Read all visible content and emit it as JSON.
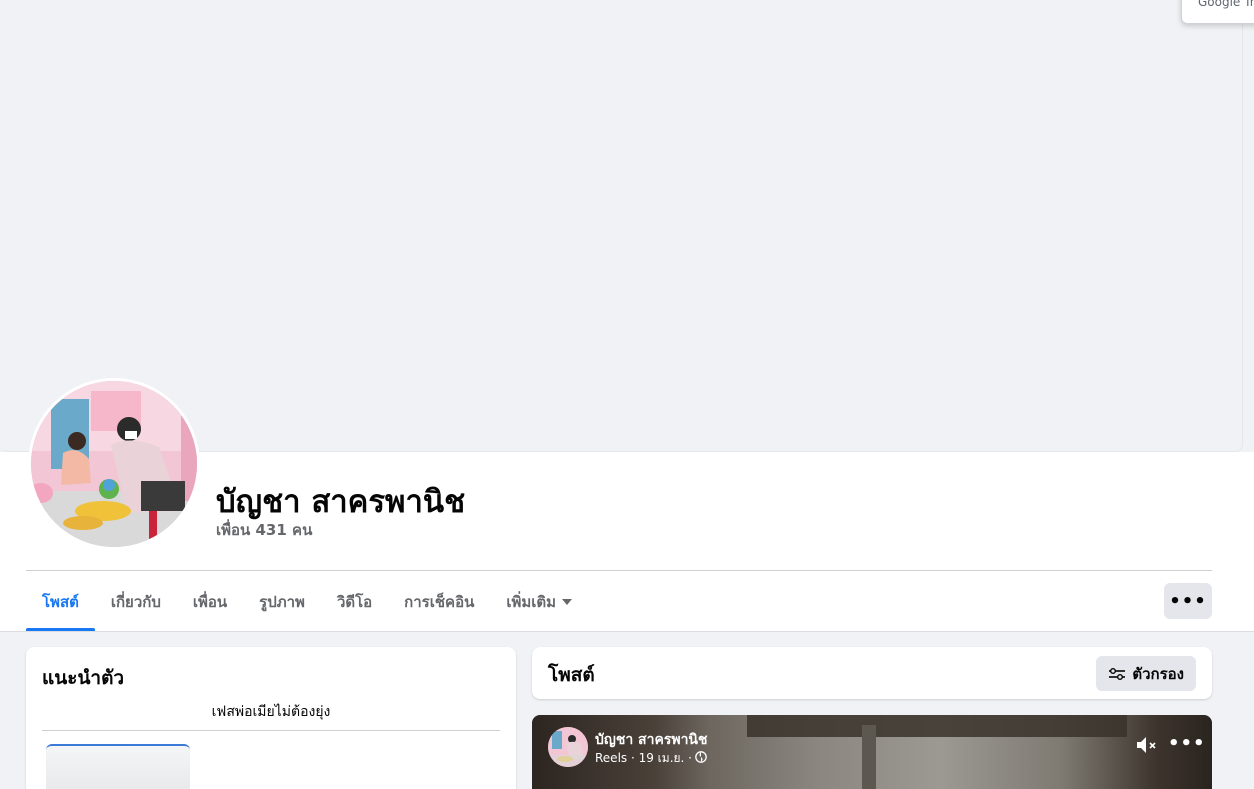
{
  "overlay": {
    "translate_text": "Google Tra"
  },
  "profile": {
    "name": "บัญชา สาครพานิช",
    "friends": "เพื่อน 431 คน"
  },
  "tabs": [
    {
      "label": "โพสต์",
      "active": true
    },
    {
      "label": "เกี่ยวกับ",
      "active": false
    },
    {
      "label": "เพื่อน",
      "active": false
    },
    {
      "label": "รูปภาพ",
      "active": false
    },
    {
      "label": "วิดีโอ",
      "active": false
    },
    {
      "label": "การเช็คอิน",
      "active": false
    },
    {
      "label": "เพิ่มเติม",
      "active": false,
      "icon": "caret-down-icon"
    }
  ],
  "actions": {
    "more_label": "•••",
    "more_icon": "more-dots-icon"
  },
  "intro": {
    "title": "แนะนำตัว",
    "bio": "เฟสพ่อเมียไม่ต้องยุ่ง"
  },
  "posts": {
    "title": "โพสต์",
    "filter_label": "ตัวกรอง",
    "filter_icon": "filter-sliders-icon"
  },
  "reel": {
    "author": "บัญชา สาครพานิช",
    "meta": "Reels · 19 เม.ย. ·",
    "privacy_icon": "globe-icon",
    "mute_icon": "speaker-muted-icon",
    "menu_label": "•••"
  },
  "colors": {
    "accent": "#1877f2",
    "secondary_text": "#65676b",
    "page_bg": "#f0f2f5",
    "button_bg": "#e4e6eb"
  }
}
